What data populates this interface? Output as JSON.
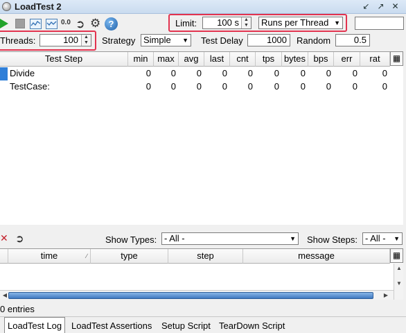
{
  "window": {
    "title": "LoadTest 2",
    "controls": [
      "restore-icon",
      "expand-icon",
      "close-icon"
    ]
  },
  "toolbar": {
    "icons": [
      "run-icon",
      "cancel-icon",
      "statistics-graph-icon",
      "statistics-history-icon",
      "reset-stats-icon",
      "export-icon",
      "options-gear-icon",
      "help-icon"
    ],
    "stat_label": "0.0",
    "help_label": "?",
    "limit_label": "Limit:",
    "limit_value": "100 s",
    "limit_type": "Runs per Thread",
    "extra_value": ""
  },
  "params": {
    "threads_label": "Threads:",
    "threads_value": "100",
    "strategy_label": "Strategy",
    "strategy_value": "Simple",
    "delay_label": "Test Delay",
    "delay_value": "1000",
    "random_label": "Random",
    "random_value": "0.5"
  },
  "main_table": {
    "columns": [
      "Test Step",
      "min",
      "max",
      "avg",
      "last",
      "cnt",
      "tps",
      "bytes",
      "bps",
      "err",
      "rat"
    ],
    "rows": [
      {
        "step": "Divide",
        "values": [
          "0",
          "0",
          "0",
          "0",
          "0",
          "0",
          "0",
          "0",
          "0",
          "0"
        ]
      },
      {
        "step": "TestCase:",
        "values": [
          "0",
          "0",
          "0",
          "0",
          "0",
          "0",
          "0",
          "0",
          "0",
          "0"
        ]
      }
    ]
  },
  "log": {
    "show_types_label": "Show Types:",
    "show_types_value": "- All -",
    "show_steps_label": "Show Steps:",
    "show_steps_value": "- All -",
    "columns": [
      "time",
      "type",
      "step",
      "message"
    ],
    "entries_text": "0 entries"
  },
  "tabs": [
    "LoadTest Log",
    "LoadTest Assertions",
    "Setup Script",
    "TearDown Script"
  ]
}
